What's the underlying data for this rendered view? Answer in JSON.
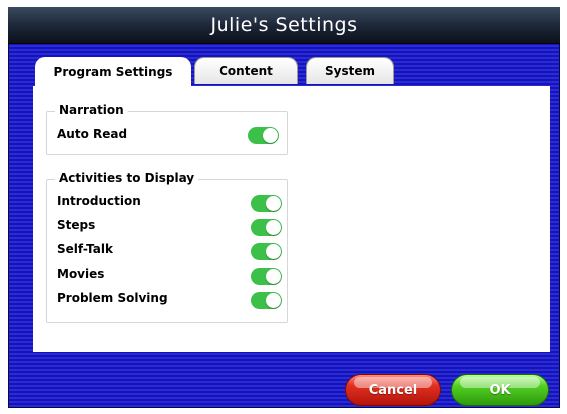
{
  "window": {
    "title": "Julie's Settings"
  },
  "tabs": [
    {
      "label": "Program Settings",
      "active": true
    },
    {
      "label": "Content",
      "active": false
    },
    {
      "label": "System",
      "active": false
    }
  ],
  "narration": {
    "legend": "Narration",
    "items": [
      {
        "label": "Auto Read",
        "on": true
      }
    ]
  },
  "activities": {
    "legend": "Activities to Display",
    "items": [
      {
        "label": "Introduction",
        "on": true
      },
      {
        "label": "Steps",
        "on": true
      },
      {
        "label": "Self-Talk",
        "on": true
      },
      {
        "label": "Movies",
        "on": true
      },
      {
        "label": "Problem Solving",
        "on": true
      }
    ]
  },
  "buttons": {
    "cancel": "Cancel",
    "ok": "OK"
  },
  "colors": {
    "background_blue": "#1414b8",
    "toggle_on": "#3cc04a",
    "cancel_red": "#e03020",
    "ok_green": "#54d024"
  }
}
